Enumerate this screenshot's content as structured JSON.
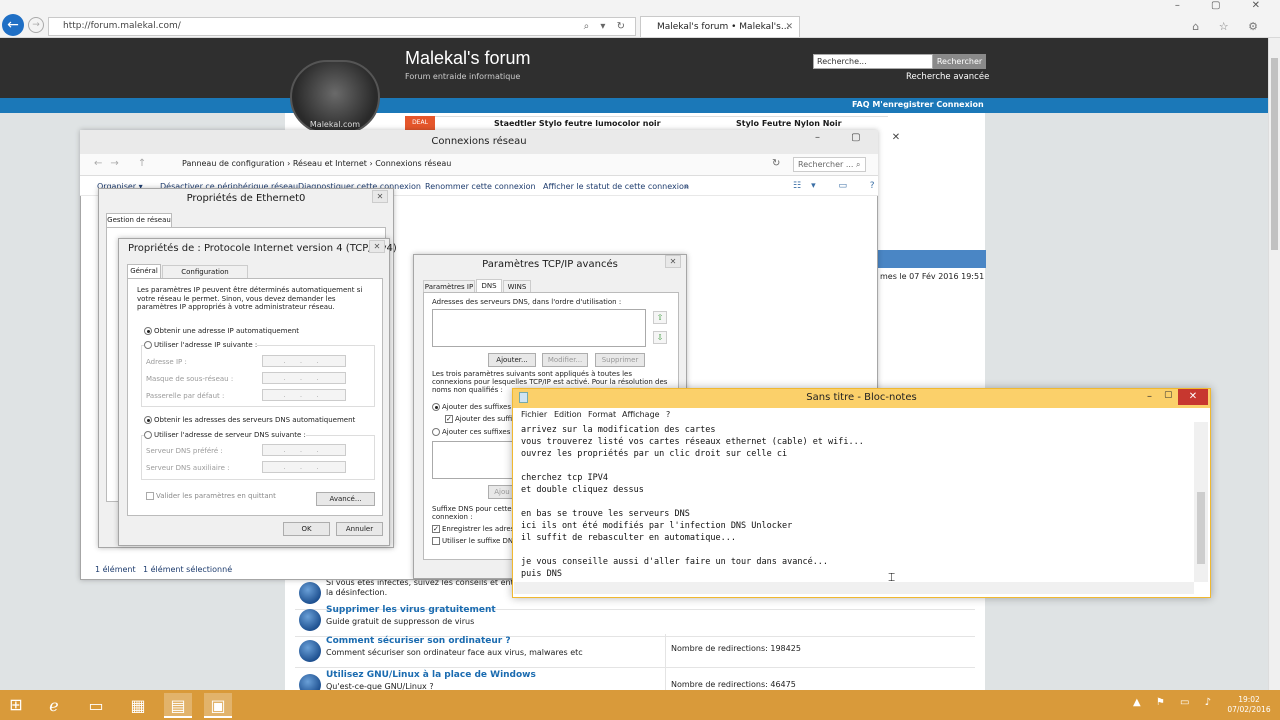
{
  "browser": {
    "address": "http://forum.malekal.com/",
    "tab_title": "Malekal's forum • Malekal's...",
    "caption_buttons": "– ▢ ✕",
    "tool_icons": "⌂ ☆ ⚙"
  },
  "forum": {
    "title": "Malekal's forum",
    "subtitle": "Forum entraide informatique",
    "logo_text": "Malekal.com",
    "search_placeholder": "Recherche...",
    "search_button": "Rechercher",
    "advanced_search": "Recherche avancée",
    "nav_links": "FAQ  M'enregistrer  Connexion",
    "ad_badge": "DEAL",
    "ad1": "Staedtler Stylo feutre lumocolor noir",
    "ad2": "Stylo Feutre Nylon Noir",
    "last_post": "mes le 07 Fév 2016 19:51",
    "rows": [
      {
        "title": "",
        "desc": "Si vous êtes infectés, suivez les conseils et entraide pour",
        "desc2": "la désinfection.",
        "redir": ""
      },
      {
        "title": "Supprimer les virus gratuitement",
        "desc": "Guide gratuit de suppresson de virus",
        "desc2": "",
        "redir": ""
      },
      {
        "title": "Comment sécuriser son ordinateur ?",
        "desc": "Comment sécuriser son ordinateur face aux virus, malwares etc",
        "desc2": "",
        "redir": "Nombre de redirections: 198425"
      },
      {
        "title": "Utilisez GNU/Linux à la place de Windows",
        "desc": "Qu'est-ce-que GNU/Linux ?",
        "desc2": "",
        "redir": "Nombre de redirections: 46475"
      }
    ]
  },
  "connexions": {
    "title": "Connexions réseau",
    "window_buttons": "– ▢ ✕",
    "breadcrumb": "Panneau de configuration  ›  Réseau et Internet  ›  Connexions réseau",
    "search_placeholder": "Rechercher ... ⌕",
    "toolbar": [
      "Organiser ▾",
      "Désactiver ce périphérique réseau",
      "Diagnostiquer cette connexion",
      "Renommer cette connexion",
      "Afficher le statut de cette connexion",
      "»"
    ],
    "status_count": "1 élément",
    "status_selected": "1 élément sélectionné"
  },
  "ethernet": {
    "title": "Propriétés de Ethernet0",
    "tab": "Gestion de réseau"
  },
  "ipv4": {
    "title": "Propriétés de : Protocole Internet version 4 (TCP/IPv4)",
    "tab_general": "Général",
    "tab_alt": "Configuration alternative",
    "description": "Les paramètres IP peuvent être déterminés automatiquement si votre réseau le permet. Sinon, vous devez demander les paramètres IP appropriés à votre administrateur réseau.",
    "opt_auto_ip": "Obtenir une adresse IP automatiquement",
    "opt_manual_ip": "Utiliser l'adresse IP suivante :",
    "label_ip": "Adresse IP :",
    "label_mask": "Masque de sous-réseau :",
    "label_gateway": "Passerelle par défaut :",
    "opt_auto_dns": "Obtenir les adresses des serveurs DNS automatiquement",
    "opt_manual_dns": "Utiliser l'adresse de serveur DNS suivante :",
    "label_dns_pref": "Serveur DNS préféré :",
    "label_dns_aux": "Serveur DNS auxiliaire :",
    "field_dots": ". . .",
    "validate": "Valider les paramètres en quittant",
    "advanced_button": "Avancé...",
    "ok_button": "OK",
    "cancel_button": "Annuler"
  },
  "tcp_advanced": {
    "title": "Paramètres TCP/IP avancés",
    "tabs": [
      "Paramètres IP",
      "DNS",
      "WINS"
    ],
    "dns_list_label": "Adresses des serveurs DNS, dans l'ordre d'utilisation :",
    "add_button": "Ajouter...",
    "modify_button": "Modifier...",
    "remove_button": "Supprimer",
    "three_params": "Les trois paramètres suivants sont appliqués à toutes les connexions pour lesquelles TCP/IP est activé. Pour la résolution des noms non qualifiés :",
    "opt_append_primary": "Ajouter des suffixes D",
    "chk_append_parent": "Ajouter des suffix",
    "opt_append_these": "Ajouter ces suffixes D",
    "add_button_partial": "Ajou",
    "suffix_label": "Suffixe DNS pour cette connexion :",
    "chk_register": "Enregistrer les adress",
    "chk_use_suffix": "Utiliser le suffixe DNS"
  },
  "notepad": {
    "title": "Sans titre - Bloc-notes",
    "menu": [
      "Fichier",
      "Edition",
      "Format",
      "Affichage",
      "?"
    ],
    "lines": [
      "arrivez sur la modification des cartes",
      "vous trouverez listé vos cartes réseaux ethernet (cable) et wifi...",
      "ouvrez les propriétés par un clic droit sur celle ci",
      "",
      "cherchez tcp IPV4",
      "et double cliquez dessus",
      "",
      "en bas se trouve les serveurs DNS",
      "ici ils ont été modifiés par l'infection DNS Unlocker",
      "il suffit de rebasculter en automatique...",
      "",
      "je vous conseille aussi d'aller faire un tour dans avancé...",
      "puis DNS"
    ]
  },
  "taskbar": {
    "time": "19:02",
    "date": "07/02/2016",
    "tray_icons": "▲ ⚑ ▭ ♪"
  }
}
